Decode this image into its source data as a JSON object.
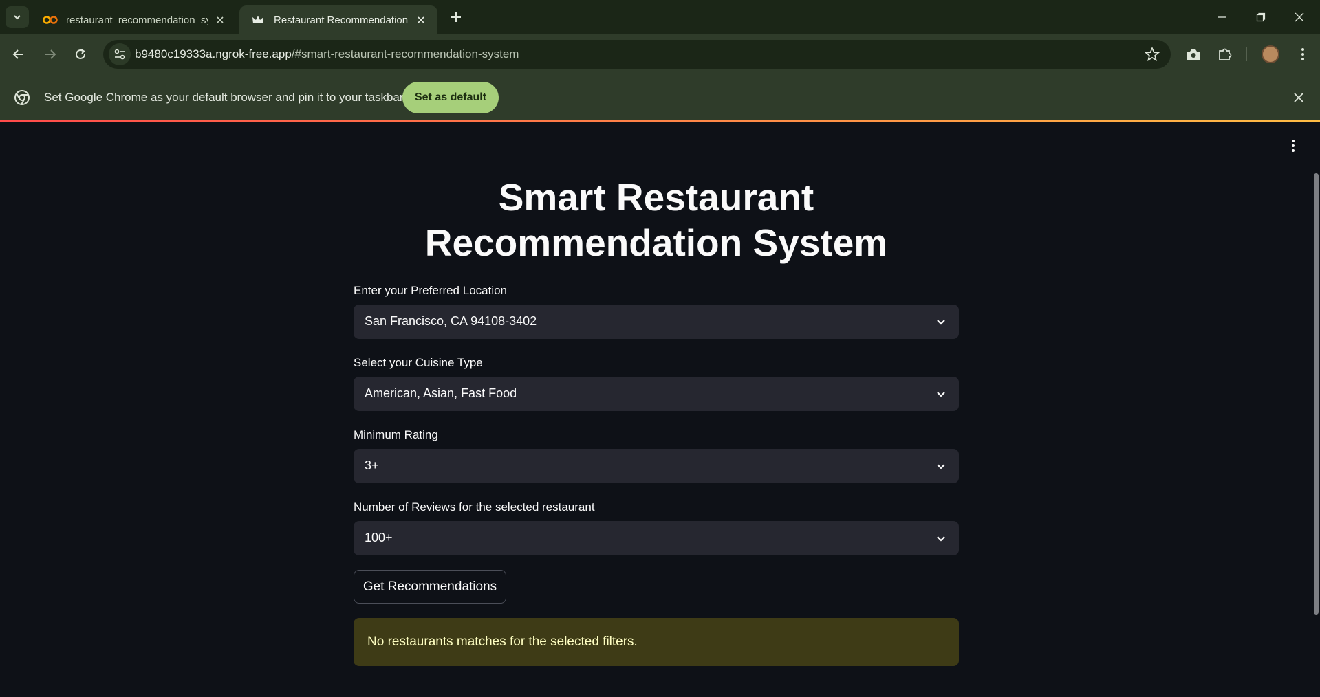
{
  "browser": {
    "tabs": [
      {
        "title": "restaurant_recommendation_sy",
        "favicon": "colab-icon",
        "active": false
      },
      {
        "title": "Restaurant Recommendation Sy",
        "favicon": "streamlit-crown-icon",
        "active": true
      }
    ],
    "url_host": "b9480c19333a.ngrok-free.app",
    "url_path": "/#smart-restaurant-recommendation-system",
    "infobar": {
      "message": "Set Google Chrome as your default browser and pin it to your taskbar",
      "button": "Set as default"
    },
    "colors": {
      "frame": "#1b2617",
      "toolbar": "#2f3c2a",
      "accent_button": "#a6cf7a"
    }
  },
  "app": {
    "title": "Smart Restaurant Recommendation System",
    "fields": [
      {
        "label": "Enter your Preferred Location",
        "value": "San Francisco, CA 94108-3402"
      },
      {
        "label": "Select your Cuisine Type",
        "value": "American, Asian, Fast Food"
      },
      {
        "label": "Minimum Rating",
        "value": "3+"
      },
      {
        "label": "Number of Reviews for the selected restaurant",
        "value": "100+"
      }
    ],
    "button": "Get Recommendations",
    "warning": "No restaurants matches for the selected filters.",
    "colors": {
      "background": "#0e1117",
      "input": "#262730",
      "warning_bg": "#3e3b16",
      "warning_text": "#ffffc2"
    }
  }
}
